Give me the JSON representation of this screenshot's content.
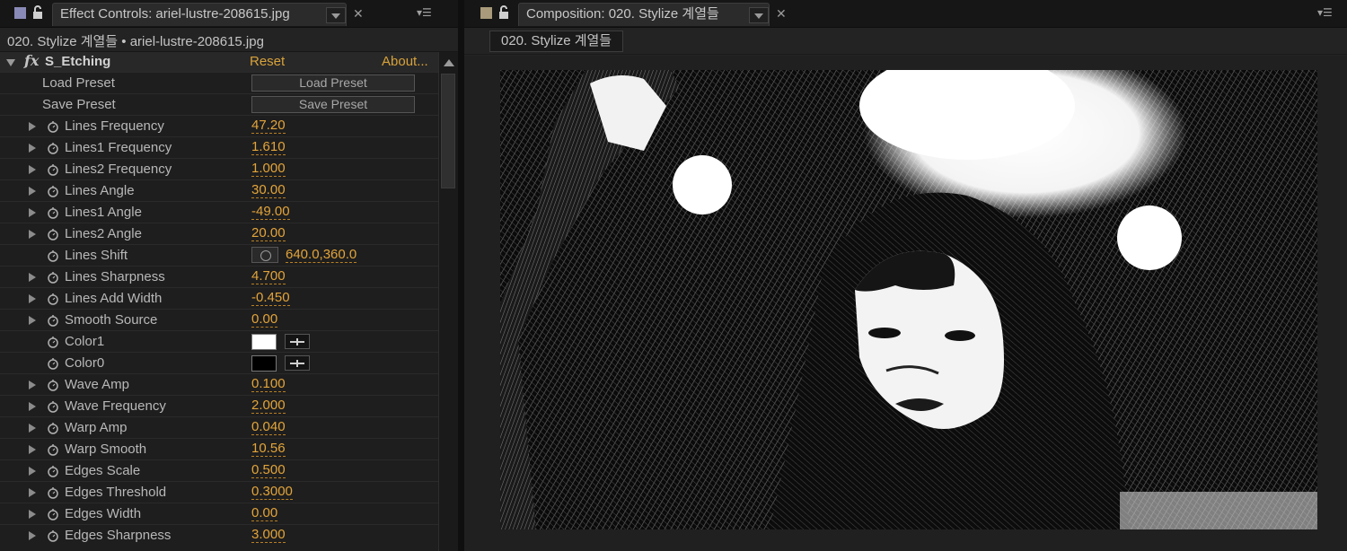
{
  "effect_controls": {
    "tab_label": "Effect Controls: ariel-lustre-208615.jpg",
    "header": "020. Stylize 계열들 • ariel-lustre-208615.jpg",
    "effect": {
      "name": "S_Etching",
      "reset": "Reset",
      "about": "About..."
    },
    "load_preset_label": "Load Preset",
    "load_preset_button": "Load Preset",
    "save_preset_label": "Save Preset",
    "save_preset_button": "Save Preset",
    "params": [
      {
        "name": "Lines Frequency",
        "value": "47.20"
      },
      {
        "name": "Lines1 Frequency",
        "value": "1.610"
      },
      {
        "name": "Lines2 Frequency",
        "value": "1.000"
      },
      {
        "name": "Lines Angle",
        "value": "30.00"
      },
      {
        "name": "Lines1 Angle",
        "value": "-49.00"
      },
      {
        "name": "Lines2 Angle",
        "value": "20.00"
      },
      {
        "name": "Lines Shift",
        "value": "640.0,360.0"
      },
      {
        "name": "Lines Sharpness",
        "value": "4.700"
      },
      {
        "name": "Lines Add Width",
        "value": "-0.450"
      },
      {
        "name": "Smooth Source",
        "value": "0.00"
      },
      {
        "name": "Color1",
        "value": "#ffffff"
      },
      {
        "name": "Color0",
        "value": "#000000"
      },
      {
        "name": "Wave Amp",
        "value": "0.100"
      },
      {
        "name": "Wave Frequency",
        "value": "2.000"
      },
      {
        "name": "Warp Amp",
        "value": "0.040"
      },
      {
        "name": "Warp Smooth",
        "value": "10.56"
      },
      {
        "name": "Edges Scale",
        "value": "0.500"
      },
      {
        "name": "Edges Threshold",
        "value": "0.3000"
      },
      {
        "name": "Edges Width",
        "value": "0.00"
      },
      {
        "name": "Edges Sharpness",
        "value": "3.000"
      }
    ]
  },
  "composition": {
    "tab_label": "Composition: 020. Stylize 계열들",
    "comp_tab": "020. Stylize 계열들"
  },
  "colors": {
    "accent": "#e3a43a",
    "panel_bg": "#1e1e1e",
    "label_color": "#cdb7a0"
  }
}
